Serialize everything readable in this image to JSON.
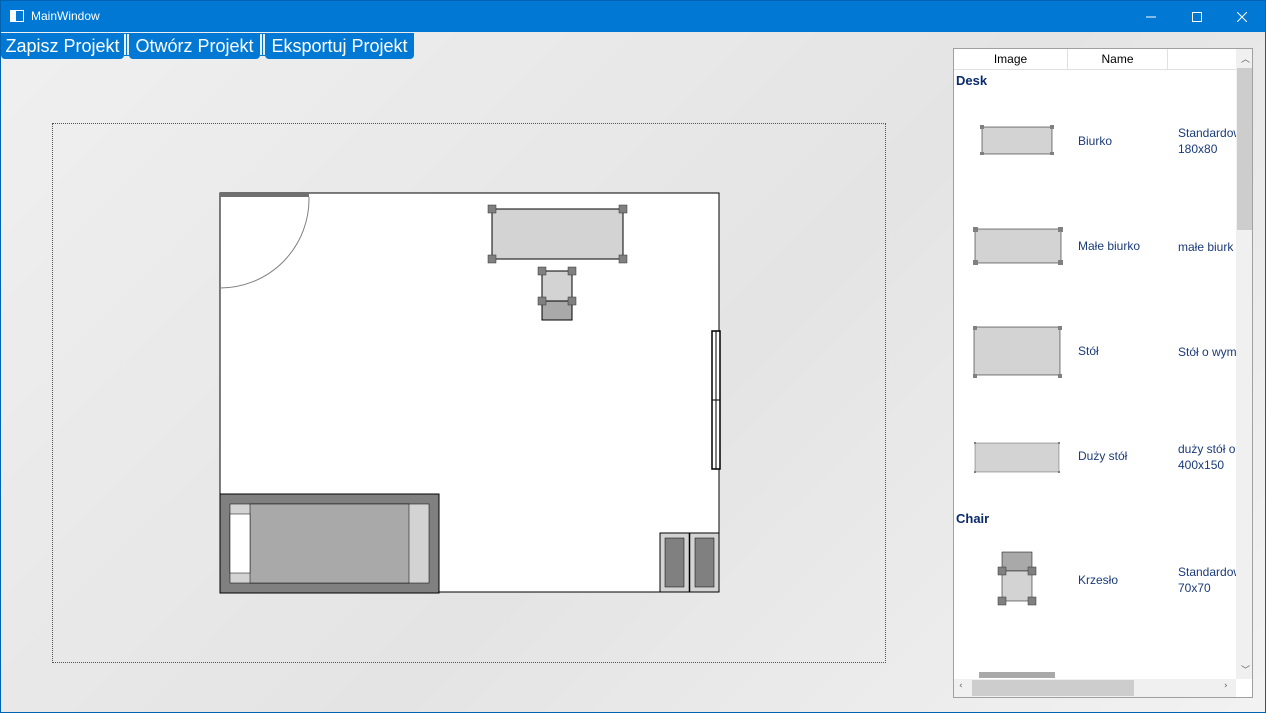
{
  "window": {
    "title": "MainWindow",
    "minimize_icon": "minimize-icon",
    "maximize_icon": "maximize-icon",
    "close_icon": "close-icon"
  },
  "toolbar": {
    "save_label": "Zapisz Projekt",
    "open_label": "Otwórz Projekt",
    "export_label": "Eksportuj Projekt"
  },
  "list": {
    "columns": [
      "Image",
      "Name"
    ],
    "groups": [
      {
        "title": "Desk",
        "items": [
          {
            "name": "Biurko",
            "desc": "Standardow 180x80"
          },
          {
            "name": "Małe biurko",
            "desc": "małe biurk"
          },
          {
            "name": "Stół",
            "desc": "Stół o wym"
          },
          {
            "name": "Duży stół",
            "desc": "duży stół o 400x150"
          }
        ]
      },
      {
        "title": "Chair",
        "items": [
          {
            "name": "Krzesło",
            "desc": "Standardow 70x70"
          }
        ]
      }
    ]
  },
  "colors": {
    "accent": "#0078d4",
    "furniture_fill": "#d3d3d3",
    "handle_fill": "#808080",
    "bed_frame": "#808080"
  }
}
